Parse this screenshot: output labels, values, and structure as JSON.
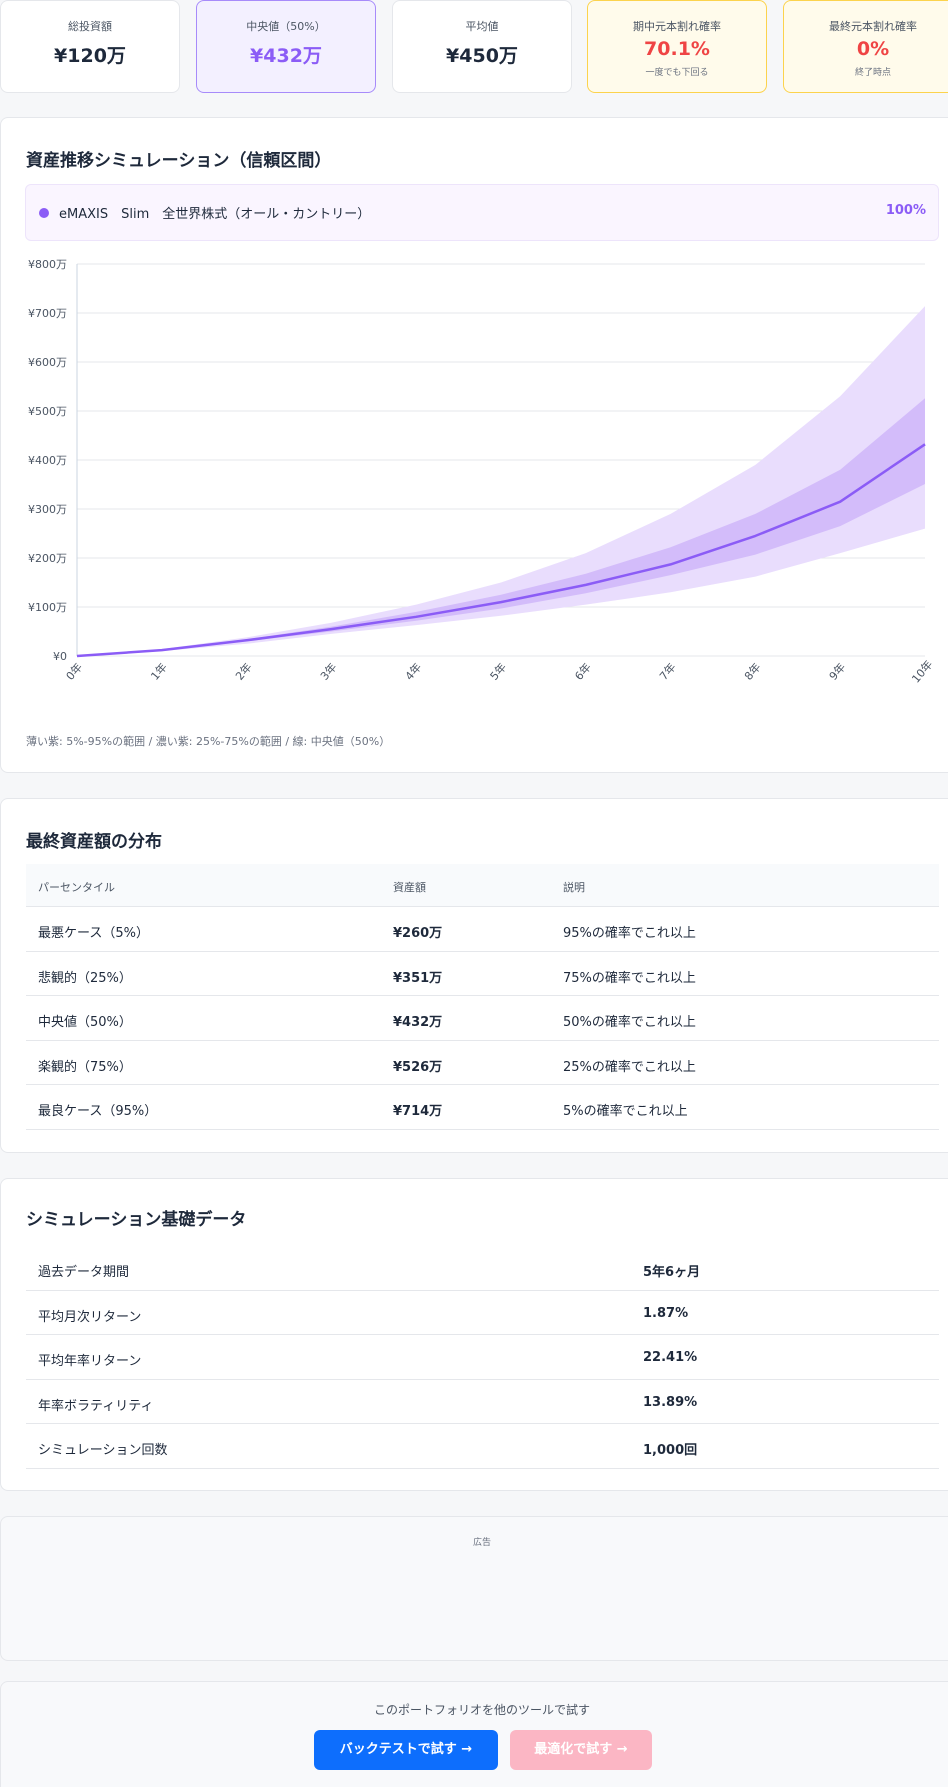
{
  "stats": {
    "total": {
      "label": "総投資額",
      "value": "¥120万"
    },
    "median": {
      "label": "中央値（50%）",
      "value": "¥432万"
    },
    "mean": {
      "label": "平均値",
      "value": "¥450万"
    },
    "interim": {
      "label": "期中元本割れ確率",
      "value": "70.1%",
      "sub": "一度でも下回る"
    },
    "final": {
      "label": "最終元本割れ確率",
      "value": "0%",
      "sub": "終了時点"
    }
  },
  "chart_section": {
    "title": "資産推移シミュレーション（信頼区間）",
    "legend_name": "eMAXIS　Slim　全世界株式（オール・カントリー）",
    "legend_pct": "100%",
    "note": "薄い紫: 5%-95%の範囲 / 濃い紫: 25%-75%の範囲 / 線: 中央値（50%）"
  },
  "chart_data": {
    "type": "area",
    "title": "",
    "xlabel": "",
    "ylabel": "",
    "x": [
      "0年",
      "1年",
      "2年",
      "3年",
      "4年",
      "5年",
      "6年",
      "7年",
      "8年",
      "9年",
      "10年"
    ],
    "y_ticks": [
      "¥0",
      "¥100万",
      "¥200万",
      "¥300万",
      "¥400万",
      "¥500万",
      "¥600万",
      "¥700万",
      "¥800万"
    ],
    "ylim": [
      0,
      800
    ],
    "units": "万円",
    "grid": true,
    "series": [
      {
        "name": "5%",
        "values": [
          0,
          10,
          25,
          45,
          63,
          82,
          105,
          130,
          162,
          210,
          260
        ]
      },
      {
        "name": "25%",
        "values": [
          0,
          12,
          30,
          50,
          72,
          97,
          128,
          165,
          207,
          265,
          351
        ]
      },
      {
        "name": "50%",
        "values": [
          0,
          12,
          32,
          55,
          80,
          110,
          145,
          187,
          245,
          315,
          432
        ]
      },
      {
        "name": "75%",
        "values": [
          0,
          13,
          34,
          60,
          90,
          125,
          168,
          222,
          290,
          380,
          526
        ]
      },
      {
        "name": "95%",
        "values": [
          0,
          14,
          38,
          68,
          105,
          150,
          210,
          290,
          390,
          530,
          714
        ]
      }
    ],
    "colors": {
      "band_outer": "#e9ddfd",
      "band_inner": "#d3bcfa",
      "median_line": "#8b5cf6",
      "grid": "#e5e7eb"
    }
  },
  "distribution": {
    "title": "最終資産額の分布",
    "headers": [
      "パーセンタイル",
      "資産額",
      "説明"
    ],
    "rows": [
      {
        "label": "最悪ケース（5%）",
        "amount": "¥260万",
        "desc": "95%の確率でこれ以上"
      },
      {
        "label": "悲観的（25%）",
        "amount": "¥351万",
        "desc": "75%の確率でこれ以上"
      },
      {
        "label": "中央値（50%）",
        "amount": "¥432万",
        "desc": "50%の確率でこれ以上"
      },
      {
        "label": "楽観的（75%）",
        "amount": "¥526万",
        "desc": "25%の確率でこれ以上"
      },
      {
        "label": "最良ケース（95%）",
        "amount": "¥714万",
        "desc": "5%の確率でこれ以上"
      }
    ]
  },
  "basis": {
    "title": "シミュレーション基礎データ",
    "rows": [
      {
        "label": "過去データ期間",
        "value": "5年6ヶ月"
      },
      {
        "label": "平均月次リターン",
        "value": "1.87%"
      },
      {
        "label": "平均年率リターン",
        "value": "22.41%"
      },
      {
        "label": "年率ボラティリティ",
        "value": "13.89%"
      },
      {
        "label": "シミュレーション回数",
        "value": "1,000回"
      }
    ]
  },
  "ad": {
    "label": "広告"
  },
  "cta": {
    "text": "このポートフォリオを他のツールで試す",
    "backtest": "バックテストで試す →",
    "optimize": "最適化で試す →"
  }
}
